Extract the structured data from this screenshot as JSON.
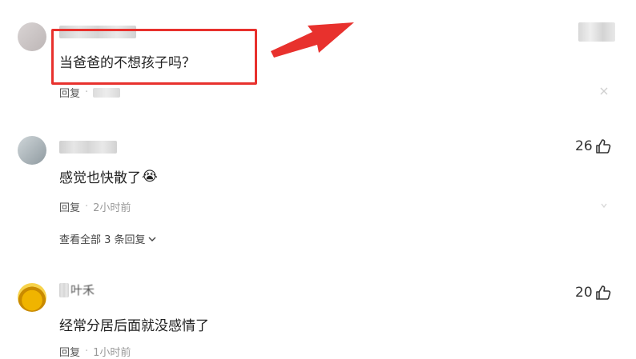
{
  "comments": [
    {
      "text": "当爸爸的不想孩子吗？",
      "reply_label": "回复",
      "dot": "·"
    },
    {
      "text": "感觉也快散了",
      "reply_label": "回复",
      "dot": "·",
      "time": "2小时前",
      "likes": "26",
      "view_replies": "查看全部 3 条回复",
      "emoji": "😭"
    },
    {
      "name": "叶禾",
      "text": "经常分居后面就没感情了",
      "reply_label": "回复",
      "dot": "·",
      "time": "1小时前",
      "likes": "20"
    }
  ],
  "icons": {
    "like": "thumbs-up-icon",
    "expand": "chevron-down-icon",
    "arrow": "red-arrow-annotation",
    "more": "dismiss-icon"
  },
  "colors": {
    "highlight": "#e8312d",
    "text": "#222222",
    "meta": "#555555",
    "time": "#999999"
  }
}
